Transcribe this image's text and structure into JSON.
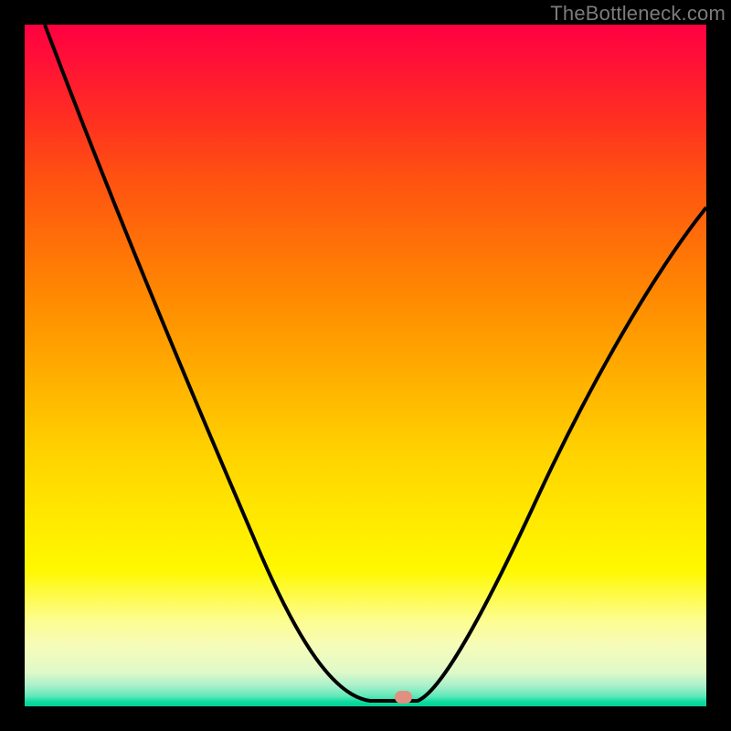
{
  "watermark": "TheBottleneck.com",
  "marker": {
    "x_frac": 0.555,
    "y_frac": 0.993
  },
  "chart_data": {
    "type": "line",
    "title": "",
    "xlabel": "",
    "ylabel": "",
    "xlim": [
      0,
      1
    ],
    "ylim": [
      0,
      1
    ],
    "series": [
      {
        "name": "bottleneck-curve",
        "x": [
          0.03,
          0.1,
          0.18,
          0.26,
          0.34,
          0.42,
          0.48,
          0.52,
          0.55,
          0.6,
          0.65,
          0.72,
          0.8,
          0.88,
          0.96,
          1.0
        ],
        "y": [
          1.0,
          0.85,
          0.69,
          0.52,
          0.35,
          0.19,
          0.07,
          0.01,
          0.0,
          0.01,
          0.07,
          0.19,
          0.35,
          0.52,
          0.67,
          0.73
        ]
      }
    ],
    "annotations": [
      {
        "type": "marker",
        "x": 0.555,
        "y": 0.007,
        "color": "#e08f80"
      }
    ],
    "background_gradient": {
      "direction": "vertical",
      "stops": [
        {
          "pos": 0.0,
          "color": "#ff0040"
        },
        {
          "pos": 0.5,
          "color": "#ffb000"
        },
        {
          "pos": 0.8,
          "color": "#fff800"
        },
        {
          "pos": 1.0,
          "color": "#00d098"
        }
      ]
    }
  }
}
